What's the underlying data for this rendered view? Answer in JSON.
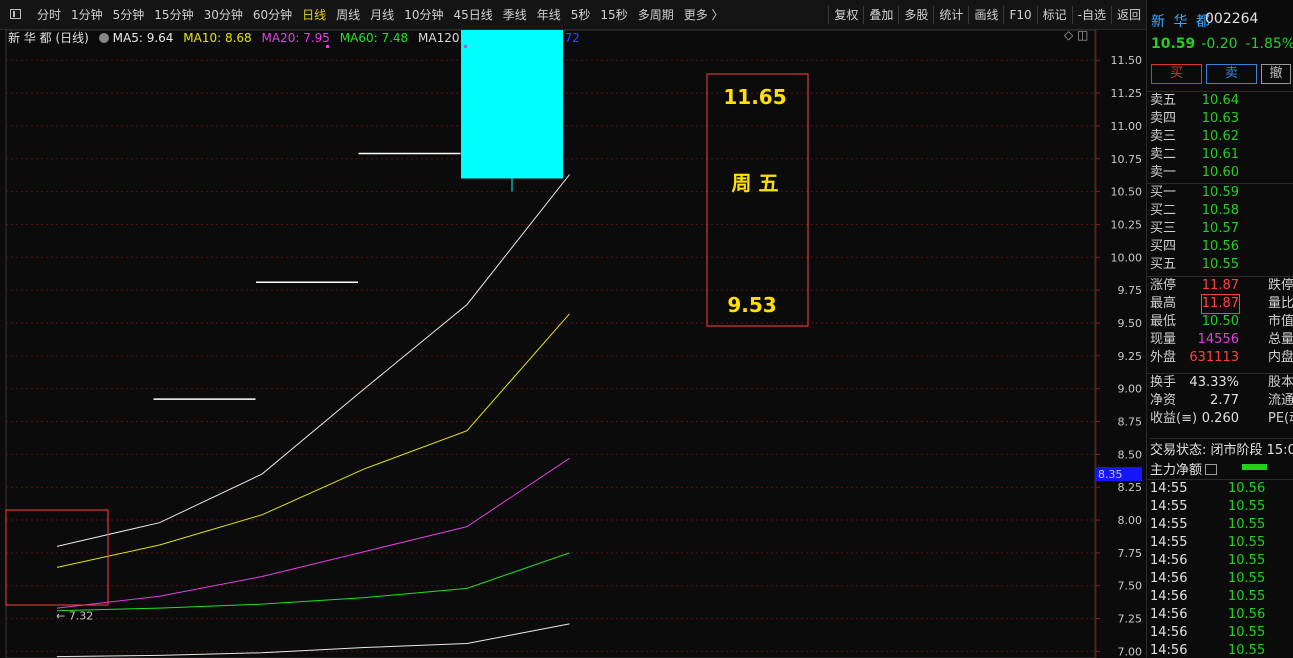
{
  "toolbar": {
    "periods": [
      "分时",
      "1分钟",
      "5分钟",
      "15分钟",
      "30分钟",
      "60分钟",
      "日线",
      "周线",
      "月线",
      "10分钟",
      "45日线",
      "季线",
      "年线",
      "5秒",
      "15秒",
      "多周期",
      "更多 〉"
    ],
    "active_period": "日线",
    "tools": [
      "复权",
      "叠加",
      "多股",
      "统计",
      "画线",
      "F10",
      "标记",
      "-自选",
      "返回"
    ]
  },
  "legend": {
    "title": "新 华 都 (日线)",
    "ma5": "MA5: 9.64",
    "ma10": "MA10: 8.68",
    "ma20": "MA20: 7.95",
    "ma60": "MA60: 7.48",
    "ma120": "MA120: 7.06",
    "ma250": "MA250: 6.72",
    "right_icons": "◇ ◫"
  },
  "colors": {
    "ma5": "#e8e8e8",
    "ma10": "#e6e600",
    "ma20": "#e040e0",
    "ma60": "#20e020",
    "ma120": "#e8e8e8",
    "ma250": "#2050ff",
    "candle_up": "#00ffff",
    "annotation": "#ffe000",
    "box": "#ff4040"
  },
  "chart_data": {
    "type": "line",
    "y_ticks": [
      "11.50",
      "11.25",
      "11.00",
      "10.75",
      "10.50",
      "10.25",
      "10.00",
      "9.75",
      "9.50",
      "9.25",
      "9.00",
      "8.75",
      "8.50",
      "8.25",
      "8.00",
      "7.75",
      "7.50",
      "7.25",
      "7.00"
    ],
    "ylim": [
      6.95,
      11.73
    ],
    "last_price_marker": "8.35",
    "x": [
      0,
      1,
      2,
      3,
      4,
      5
    ],
    "series": [
      {
        "key": "ma5",
        "values": [
          7.8,
          7.98,
          8.35,
          9.0,
          9.64,
          10.63
        ]
      },
      {
        "key": "ma10",
        "values": [
          7.64,
          7.81,
          8.04,
          8.39,
          8.68,
          9.57
        ]
      },
      {
        "key": "ma20",
        "values": [
          7.33,
          7.42,
          7.57,
          7.76,
          7.95,
          8.47
        ]
      },
      {
        "key": "ma60",
        "values": [
          7.31,
          7.33,
          7.36,
          7.41,
          7.48,
          7.75
        ]
      },
      {
        "key": "ma120",
        "values": [
          6.96,
          6.97,
          6.99,
          7.03,
          7.06,
          7.21
        ]
      }
    ],
    "ohlc": [
      {
        "x": 1,
        "o": 8.92,
        "h": 8.92,
        "l": 8.92,
        "c": 8.92
      },
      {
        "x": 2,
        "o": 9.81,
        "h": 9.81,
        "l": 9.81,
        "c": 9.81
      },
      {
        "x": 3,
        "o": 10.79,
        "h": 10.79,
        "l": 10.79,
        "c": 10.79
      },
      {
        "x": 4,
        "o": 10.6,
        "h": 11.87,
        "l": 10.5,
        "c": 11.87
      }
    ],
    "annotations": {
      "high_label": "11.87",
      "low_label": "7.32",
      "box_top_value": "11.65",
      "box_day": "周 五",
      "box_bottom_value": "9.53"
    }
  },
  "quote": {
    "name": "新 华 都",
    "code": "002264",
    "price": "10.59",
    "change": "-0.20",
    "change_pct": "-1.85%",
    "buy_label": "买",
    "sell_label": "卖",
    "third_label": "撤",
    "asks": [
      {
        "label": "卖五",
        "price": "10.64"
      },
      {
        "label": "卖四",
        "price": "10.63"
      },
      {
        "label": "卖三",
        "price": "10.62"
      },
      {
        "label": "卖二",
        "price": "10.61"
      },
      {
        "label": "卖一",
        "price": "10.60"
      }
    ],
    "bids": [
      {
        "label": "买一",
        "price": "10.59"
      },
      {
        "label": "买二",
        "price": "10.58"
      },
      {
        "label": "买三",
        "price": "10.57"
      },
      {
        "label": "买四",
        "price": "10.56"
      },
      {
        "label": "买五",
        "price": "10.55"
      }
    ],
    "stats1": [
      {
        "label": "涨停",
        "value": "11.87",
        "right": "跌停"
      },
      {
        "label": "最高",
        "value": "11.87",
        "right": "量比"
      },
      {
        "label": "最低",
        "value": "10.50",
        "right": "市值"
      },
      {
        "label": "现量",
        "value": "14556",
        "right": "总量"
      },
      {
        "label": "外盘",
        "value": "631113",
        "right": "内盘"
      }
    ],
    "stats2": [
      {
        "label": "换手",
        "value": "43.33%",
        "right": "股本"
      },
      {
        "label": "净资",
        "value": "2.77",
        "right": "流通"
      },
      {
        "label": "收益(≡)",
        "value": "0.260",
        "right": "PE(动"
      }
    ],
    "status": "交易状态: 闭市阶段 15:0",
    "flow_label": "主力净额",
    "ticks": [
      {
        "t": "14:55",
        "p": "10.56"
      },
      {
        "t": "14:55",
        "p": "10.55"
      },
      {
        "t": "14:55",
        "p": "10.55"
      },
      {
        "t": "14:55",
        "p": "10.55"
      },
      {
        "t": "14:56",
        "p": "10.55"
      },
      {
        "t": "14:56",
        "p": "10.55"
      },
      {
        "t": "14:56",
        "p": "10.55"
      },
      {
        "t": "14:56",
        "p": "10.56"
      },
      {
        "t": "14:56",
        "p": "10.55"
      },
      {
        "t": "14:56",
        "p": "10.55"
      }
    ]
  }
}
